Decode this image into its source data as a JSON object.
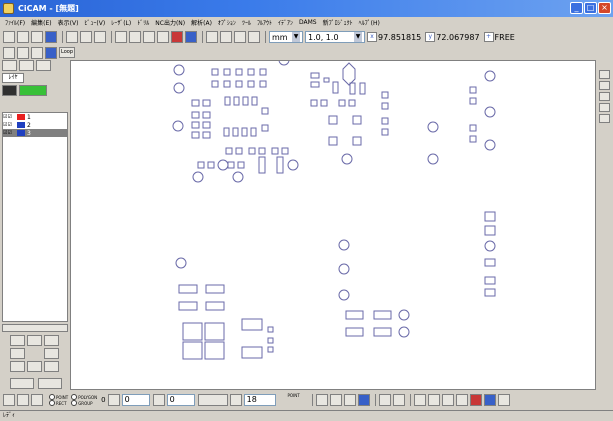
{
  "window": {
    "title": "CiCAM - [無題]",
    "minimize": "_",
    "maximize": "□",
    "close": "×"
  },
  "menu": [
    "ﾌｧｲﾙ(F)",
    "編集(E)",
    "表示(V)",
    "ﾋﾞｭｰ(V)",
    "ﾚｰｻﾞ(L)",
    "ﾄﾞﾘﾙ",
    "NC出力(N)",
    "解析(A)",
    "ｵﾌﾟｼｮﾝ",
    "ﾂｰﾙ",
    "ﾌﾙｱｳﾄ",
    "ｲﾃﾞｱﾝ",
    "DAMS",
    "新ﾌﾟﾛｼﾞｪｸﾄ",
    "ﾍﾙﾌﾟ(H)"
  ],
  "toolbar": {
    "unit": "mm",
    "scale": "1.0, 1.0",
    "x_coord": "97.851815",
    "y_coord": "72.067987",
    "snap": "FREE",
    "loop": "Loop"
  },
  "layers": {
    "header": "ﾚｲﾔ",
    "items": [
      {
        "name": "1",
        "color": "#e82020",
        "selected": false
      },
      {
        "name": "2",
        "color": "#2040c0",
        "selected": false
      },
      {
        "name": "3",
        "color": "#2040c0",
        "selected": true
      }
    ]
  },
  "bottombar": {
    "radios": [
      "POINT",
      "POLYGON",
      "RECT",
      "GROUP"
    ],
    "field1_label": "0",
    "field1": "0",
    "field2": "0",
    "field3": "18",
    "point_label": "POINT"
  },
  "status": {
    "text": "ﾚﾃﾞｨ"
  }
}
